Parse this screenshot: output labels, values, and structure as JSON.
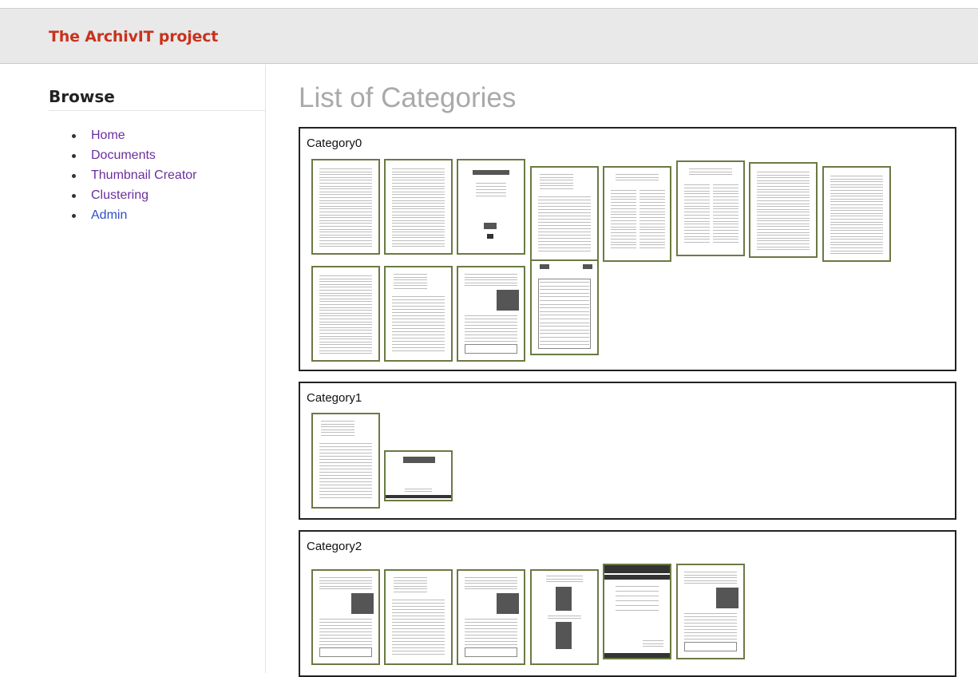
{
  "header": {
    "brand": "The ArchivIT project"
  },
  "sidebar": {
    "title": "Browse",
    "items": [
      {
        "label": "Home",
        "visited": true
      },
      {
        "label": "Documents",
        "visited": true
      },
      {
        "label": "Thumbnail Creator",
        "visited": true
      },
      {
        "label": "Clustering",
        "visited": true
      },
      {
        "label": "Admin",
        "visited": false
      }
    ]
  },
  "main": {
    "title": "List of Categories",
    "categories": [
      {
        "name": "Category0",
        "document_count": 12
      },
      {
        "name": "Category1",
        "document_count": 2
      },
      {
        "name": "Category2",
        "document_count": 6
      }
    ]
  },
  "colors": {
    "brand": "#c8321e",
    "visited_link": "#6a2f9e",
    "link": "#2f4fc9",
    "page_title": "#a9a9a9",
    "thumbnail_border": "#6b7a44",
    "header_bg": "#e9e9e9"
  }
}
